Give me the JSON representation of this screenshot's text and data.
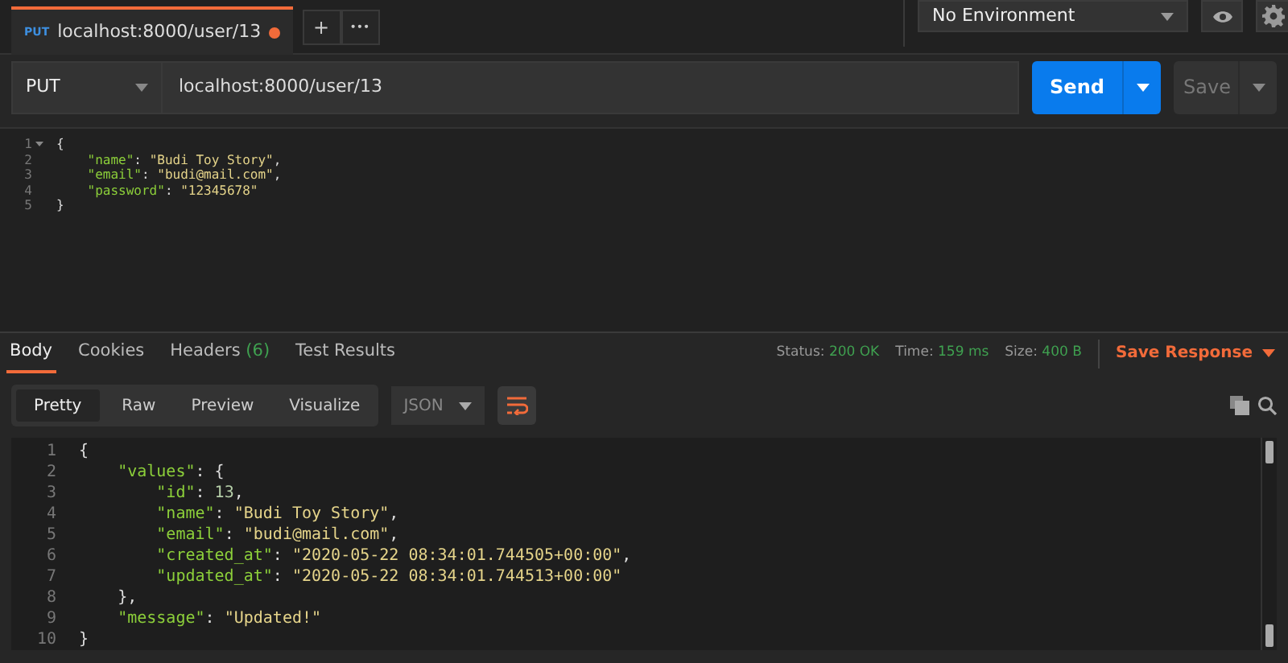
{
  "request_tab": {
    "method": "PUT",
    "title": "localhost:8000/user/13",
    "unsaved": true
  },
  "tab_actions": [
    "+",
    "•••"
  ],
  "environment": {
    "value": "No Environment"
  },
  "request": {
    "method": "PUT",
    "url": "localhost:8000/user/13",
    "send": "Send",
    "save": "Save"
  },
  "request_body": {
    "lines": [
      {
        "number": "1",
        "foldable": true,
        "tokens": [
          {
            "kind": "punct",
            "text": "{"
          }
        ]
      },
      {
        "number": "2",
        "foldable": false,
        "tokens": [
          {
            "kind": "key",
            "text": "    \"name\""
          },
          {
            "kind": "punct",
            "text": ": "
          },
          {
            "kind": "string",
            "text": "\"Budi Toy Story\""
          },
          {
            "kind": "punct",
            "text": ","
          }
        ]
      },
      {
        "number": "3",
        "foldable": false,
        "tokens": [
          {
            "kind": "key",
            "text": "    \"email\""
          },
          {
            "kind": "punct",
            "text": ": "
          },
          {
            "kind": "string",
            "text": "\"budi@mail.com\""
          },
          {
            "kind": "punct",
            "text": ","
          }
        ]
      },
      {
        "number": "4",
        "foldable": false,
        "tokens": [
          {
            "kind": "key",
            "text": "    \"password\""
          },
          {
            "kind": "punct",
            "text": ": "
          },
          {
            "kind": "string",
            "text": "\"12345678\""
          }
        ]
      },
      {
        "number": "5",
        "foldable": false,
        "tokens": [
          {
            "kind": "punct",
            "text": "}"
          }
        ]
      }
    ]
  },
  "response_tabs": [
    {
      "label": "Body",
      "selected": true
    },
    {
      "label": "Cookies",
      "selected": false
    },
    {
      "label": "Headers",
      "count": "(6)",
      "selected": false
    },
    {
      "label": "Test Results",
      "selected": false
    }
  ],
  "response_meta": [
    {
      "label": "Status:",
      "value": "200 OK"
    },
    {
      "label": "Time:",
      "value": "159 ms"
    },
    {
      "label": "Size:",
      "value": "400 B"
    }
  ],
  "save_response": "Save Response",
  "view_modes": [
    {
      "label": "Pretty",
      "selected": true
    },
    {
      "label": "Raw",
      "selected": false
    },
    {
      "label": "Preview",
      "selected": false
    },
    {
      "label": "Visualize",
      "selected": false
    }
  ],
  "format": {
    "value": "JSON"
  },
  "wrap_lines": true,
  "response_body": {
    "lines": [
      {
        "number": "1",
        "tokens": [
          {
            "kind": "punct",
            "text": "{"
          }
        ]
      },
      {
        "number": "2",
        "tokens": [
          {
            "kind": "key",
            "text": "    \"values\""
          },
          {
            "kind": "punct",
            "text": ": {"
          }
        ]
      },
      {
        "number": "3",
        "tokens": [
          {
            "kind": "key",
            "text": "        \"id\""
          },
          {
            "kind": "punct",
            "text": ": "
          },
          {
            "kind": "number",
            "text": "13"
          },
          {
            "kind": "punct",
            "text": ","
          }
        ]
      },
      {
        "number": "4",
        "tokens": [
          {
            "kind": "key",
            "text": "        \"name\""
          },
          {
            "kind": "punct",
            "text": ": "
          },
          {
            "kind": "string",
            "text": "\"Budi Toy Story\""
          },
          {
            "kind": "punct",
            "text": ","
          }
        ]
      },
      {
        "number": "5",
        "tokens": [
          {
            "kind": "key",
            "text": "        \"email\""
          },
          {
            "kind": "punct",
            "text": ": "
          },
          {
            "kind": "string",
            "text": "\"budi@mail.com\""
          },
          {
            "kind": "punct",
            "text": ","
          }
        ]
      },
      {
        "number": "6",
        "tokens": [
          {
            "kind": "key",
            "text": "        \"created_at\""
          },
          {
            "kind": "punct",
            "text": ": "
          },
          {
            "kind": "string",
            "text": "\"2020-05-22 08:34:01.744505+00:00\""
          },
          {
            "kind": "punct",
            "text": ","
          }
        ]
      },
      {
        "number": "7",
        "tokens": [
          {
            "kind": "key",
            "text": "        \"updated_at\""
          },
          {
            "kind": "punct",
            "text": ": "
          },
          {
            "kind": "string",
            "text": "\"2020-05-22 08:34:01.744513+00:00\""
          }
        ]
      },
      {
        "number": "8",
        "tokens": [
          {
            "kind": "punct",
            "text": "    },"
          }
        ]
      },
      {
        "number": "9",
        "tokens": [
          {
            "kind": "key",
            "text": "    \"message\""
          },
          {
            "kind": "punct",
            "text": ": "
          },
          {
            "kind": "string",
            "text": "\"Updated!\""
          }
        ]
      },
      {
        "number": "10",
        "tokens": [
          {
            "kind": "punct",
            "text": "}"
          }
        ]
      }
    ]
  }
}
